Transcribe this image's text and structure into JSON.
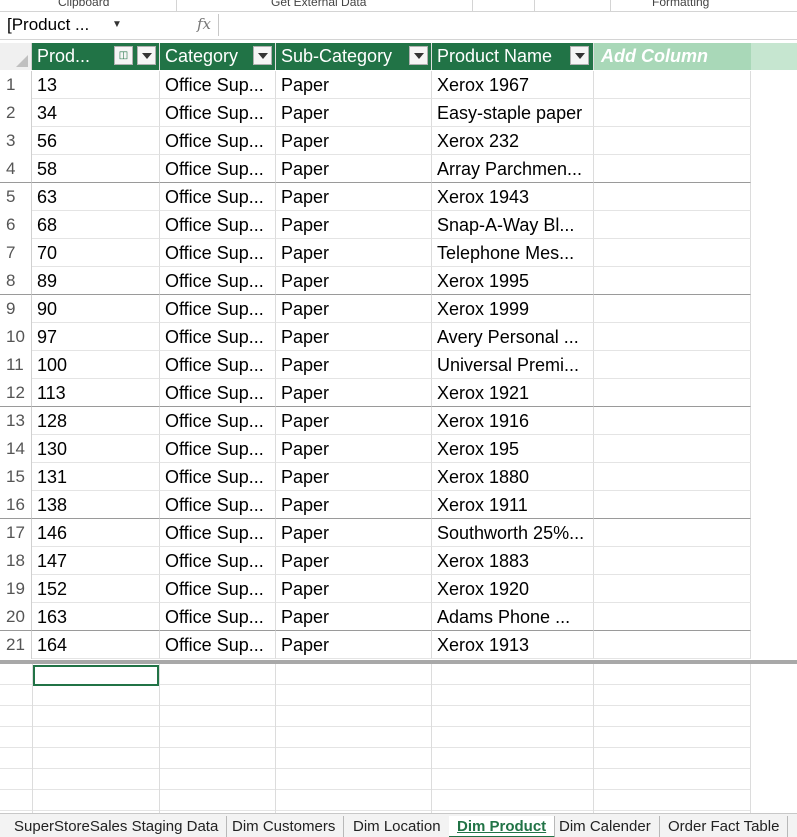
{
  "ribbon": {
    "groups": [
      "Clipboard",
      "Get External Data",
      "Formatting"
    ]
  },
  "formula_bar": {
    "name_box": "[Product ...",
    "fx": "fx",
    "value": ""
  },
  "grid": {
    "columns": [
      {
        "label": "Prod...",
        "has_key_icon": true
      },
      {
        "label": "Category"
      },
      {
        "label": "Sub-Category"
      },
      {
        "label": "Product Name"
      }
    ],
    "add_column_label": "Add Column",
    "rows": [
      [
        "1",
        "13",
        "Office Sup...",
        "Paper",
        "Xerox 1967"
      ],
      [
        "2",
        "34",
        "Office Sup...",
        "Paper",
        "Easy-staple paper"
      ],
      [
        "3",
        "56",
        "Office Sup...",
        "Paper",
        "Xerox 232"
      ],
      [
        "4",
        "58",
        "Office Sup...",
        "Paper",
        "Array Parchmen..."
      ],
      [
        "5",
        "63",
        "Office Sup...",
        "Paper",
        "Xerox 1943"
      ],
      [
        "6",
        "68",
        "Office Sup...",
        "Paper",
        "Snap-A-Way Bl..."
      ],
      [
        "7",
        "70",
        "Office Sup...",
        "Paper",
        "Telephone Mes..."
      ],
      [
        "8",
        "89",
        "Office Sup...",
        "Paper",
        "Xerox 1995"
      ],
      [
        "9",
        "90",
        "Office Sup...",
        "Paper",
        "Xerox 1999"
      ],
      [
        "10",
        "97",
        "Office Sup...",
        "Paper",
        "Avery Personal ..."
      ],
      [
        "11",
        "100",
        "Office Sup...",
        "Paper",
        "Universal Premi..."
      ],
      [
        "12",
        "113",
        "Office Sup...",
        "Paper",
        "Xerox 1921"
      ],
      [
        "13",
        "128",
        "Office Sup...",
        "Paper",
        "Xerox 1916"
      ],
      [
        "14",
        "130",
        "Office Sup...",
        "Paper",
        "Xerox 195"
      ],
      [
        "15",
        "131",
        "Office Sup...",
        "Paper",
        "Xerox 1880"
      ],
      [
        "16",
        "138",
        "Office Sup...",
        "Paper",
        "Xerox 1911"
      ],
      [
        "17",
        "146",
        "Office Sup...",
        "Paper",
        "Southworth 25%..."
      ],
      [
        "18",
        "147",
        "Office Sup...",
        "Paper",
        "Xerox 1883"
      ],
      [
        "19",
        "152",
        "Office Sup...",
        "Paper",
        "Xerox 1920"
      ],
      [
        "20",
        "163",
        "Office Sup...",
        "Paper",
        "Adams Phone ..."
      ],
      [
        "21",
        "164",
        "Office Sup...",
        "Paper",
        "Xerox 1913"
      ]
    ]
  },
  "sheet_tabs": [
    {
      "label": "SuperStoreSales Staging Data",
      "active": false
    },
    {
      "label": "Dim Customers",
      "active": false
    },
    {
      "label": "Dim Location",
      "active": false
    },
    {
      "label": "Dim Product",
      "active": true
    },
    {
      "label": "Dim Calender",
      "active": false
    },
    {
      "label": "Order Fact Table",
      "active": false
    }
  ],
  "colors": {
    "header_bg": "#217346",
    "add_column_bg": "#a9d8b8",
    "active_tab": "#217346"
  }
}
